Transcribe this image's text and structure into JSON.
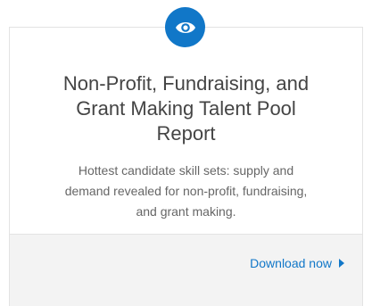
{
  "card": {
    "icon": "eye-icon",
    "accent_color": "#1177c8",
    "title_line_1": "Non-Profit, Fundraising, and",
    "title_line_2": "Grant Making Talent Pool",
    "title_line_3": "Report",
    "description_line_1": "Hottest candidate skill sets: supply and",
    "description_line_2": "demand revealed for non-profit, fundraising,",
    "description_line_3": "and grant making.",
    "cta_label": "Download now"
  }
}
